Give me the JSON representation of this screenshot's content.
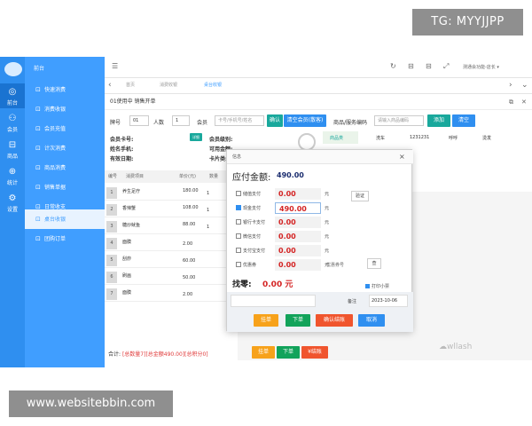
{
  "watermark": {
    "top": "TG: MYYJJPP",
    "bottom": "www.websitebbin.com",
    "logo": "☁wllash"
  },
  "rail": {
    "items": [
      {
        "icon": "◎",
        "label": "前台",
        "active": true
      },
      {
        "icon": "⚇",
        "label": "会员",
        "active": false
      },
      {
        "icon": "⊟",
        "label": "商品",
        "active": false
      },
      {
        "icon": "⊕",
        "label": "统计",
        "active": false
      },
      {
        "icon": "⚙",
        "label": "设置",
        "active": false
      }
    ]
  },
  "sidebar": {
    "title": "前台",
    "items": [
      {
        "icon": "⊡",
        "label": "快速消费",
        "active": false
      },
      {
        "icon": "⊡",
        "label": "消费收银",
        "active": false
      },
      {
        "icon": "⊡",
        "label": "会员充值",
        "active": false
      },
      {
        "icon": "⊡",
        "label": "计次消费",
        "active": false
      },
      {
        "icon": "⊡",
        "label": "商品消费",
        "active": false
      },
      {
        "icon": "⊡",
        "label": "销售单据",
        "active": false
      },
      {
        "icon": "⊡",
        "label": "日常收支",
        "active": false
      },
      {
        "icon": "⊡",
        "label": "桌台收银",
        "active": true
      },
      {
        "icon": "⊡",
        "label": "团购订单",
        "active": false
      }
    ]
  },
  "topbar": {
    "menu_icon": "☰",
    "icons": [
      "↻",
      "⊟",
      "⊟",
      "⤢"
    ],
    "user": "测通会功能-店长 ▾"
  },
  "tabs": {
    "items": [
      "首页",
      "消费收银",
      "桌台收银"
    ]
  },
  "content": {
    "strip": "01使用中  销售开单",
    "table_no_label": "牌号",
    "table_no": "01",
    "people_label": "人数",
    "people": "1",
    "member_label": "会员",
    "member_placeholder": "卡号/手机号/姓名",
    "confirm": "确认",
    "clear_member": "清空会员(散客)",
    "product_label": "商品/服务编码",
    "product_placeholder": "请输入商品编码",
    "add": "添加",
    "clear": "清空",
    "card_no": "会员卡号:",
    "detail_btn": "详细",
    "level": "会员级别:",
    "name": "姓名手机:",
    "balance": "可用金额:",
    "expiry": "有效日期:",
    "card_points": "卡片类:",
    "categories": [
      "商品类",
      "洗车",
      "1231231",
      "呼呼",
      "烫发"
    ],
    "table_header": [
      "编号",
      "消费项目",
      "单价(元)",
      "数量"
    ],
    "rows": [
      {
        "no": "1",
        "name": "养生足疗",
        "price": "180.00",
        "qty": "1"
      },
      {
        "no": "2",
        "name": "香辣蟹",
        "price": "108.00",
        "qty": "1"
      },
      {
        "no": "3",
        "name": "糖炒鱿鱼",
        "price": "88.00",
        "qty": "1"
      },
      {
        "no": "4",
        "name": "面膜",
        "price": "",
        "qty": "2.00"
      },
      {
        "no": "5",
        "name": "刮痧",
        "price": "",
        "qty": "60.00"
      },
      {
        "no": "6",
        "name": "刷画",
        "price": "",
        "qty": "50.00"
      },
      {
        "no": "7",
        "name": "面膜",
        "price": "",
        "qty": "2.00"
      }
    ],
    "summary_prefix": "合计:",
    "summary_value": "[总数量7][总金额490.00][总积分0]",
    "bottom_buttons": [
      "挂单",
      "下单",
      "¥结账"
    ]
  },
  "modal": {
    "title": "信息",
    "close": "×",
    "due_label": "应付金额:",
    "due_value": "490.00",
    "verify": "验证",
    "unit": "元",
    "payments": [
      {
        "label": "储值支付",
        "value": "0.00",
        "checked": false
      },
      {
        "label": "现金支付",
        "value": "490.00",
        "checked": true
      },
      {
        "label": "银行卡支付",
        "value": "0.00",
        "checked": false
      },
      {
        "label": "微信支付",
        "value": "0.00",
        "checked": false
      },
      {
        "label": "支付宝支付",
        "value": "0.00",
        "checked": false
      },
      {
        "label": "优惠券",
        "value": "0.00",
        "checked": false
      }
    ],
    "coupon_no_label": "优惠券号",
    "coupon_btn": "查",
    "change_label": "找零:",
    "change_value": "0.00 元",
    "print_label": "打印小票",
    "note_label": "备注",
    "date": "2023-10-06",
    "buttons": [
      "挂单",
      "下单",
      "确认结账",
      "取消"
    ]
  }
}
